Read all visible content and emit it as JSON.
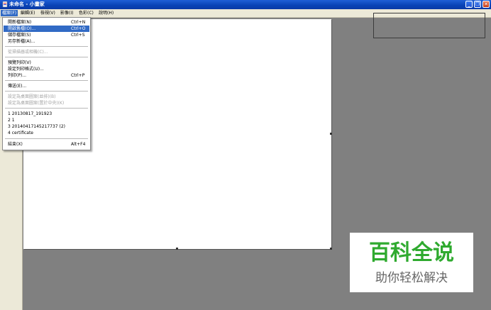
{
  "window": {
    "title": "未命名 - 小畫家",
    "min_glyph": "_",
    "max_glyph": "❐",
    "close_glyph": "✕"
  },
  "menubar": {
    "items": [
      "檔案(F)",
      "編輯(E)",
      "檢視(V)",
      "影像(I)",
      "色彩(C)",
      "說明(H)"
    ],
    "active_index": 0
  },
  "file_menu": {
    "items": [
      {
        "label": "開新檔案(N)",
        "shortcut": "Ctrl+N"
      },
      {
        "label": "開啟舊檔(O)...",
        "shortcut": "Ctrl+O"
      },
      {
        "label": "儲存檔案(S)",
        "shortcut": "Ctrl+S"
      },
      {
        "label": "另存新檔(A)...",
        "shortcut": ""
      },
      {
        "label": "從掃描器或相機(C)...",
        "shortcut": ""
      },
      {
        "label": "預覽列印(V)",
        "shortcut": ""
      },
      {
        "label": "設定列印格式(U)...",
        "shortcut": ""
      },
      {
        "label": "列印(P)...",
        "shortcut": "Ctrl+P"
      },
      {
        "label": "傳送(E)...",
        "shortcut": ""
      },
      {
        "label": "設定為桌面圖案(並排)(B)",
        "shortcut": ""
      },
      {
        "label": "設定為桌面圖案(置於中央)(K)",
        "shortcut": ""
      },
      {
        "label": "1 20130817_191923",
        "shortcut": ""
      },
      {
        "label": "2 1",
        "shortcut": ""
      },
      {
        "label": "3 20140417145217737 (2)",
        "shortcut": ""
      },
      {
        "label": "4 certificate",
        "shortcut": ""
      },
      {
        "label": "結束(X)",
        "shortcut": "Alt+F4"
      }
    ],
    "highlighted_index": 1,
    "disabled_indices": [
      4,
      9,
      10
    ]
  },
  "watermark": {
    "title": "百科全说",
    "subtitle": "助你轻松解决"
  },
  "colors": {
    "workspace": "#808080",
    "menu_highlight": "#316ac5",
    "titlebar": "#0842b5",
    "watermark_green": "#2faa2f"
  }
}
